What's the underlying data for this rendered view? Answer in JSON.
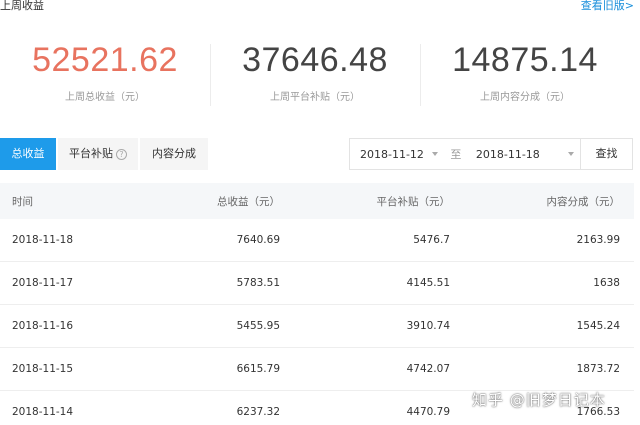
{
  "header": {
    "title": "上周收益",
    "old_version_link": "查看旧版>"
  },
  "summary": [
    {
      "value": "52521.62",
      "label": "上周总收益（元）"
    },
    {
      "value": "37646.48",
      "label": "上周平台补贴（元）"
    },
    {
      "value": "14875.14",
      "label": "上周内容分成（元）"
    }
  ],
  "colors": {
    "accent": "#e8735f",
    "tab_active": "#1e9bea",
    "link": "#1a8fdb"
  },
  "tabs": [
    {
      "label": "总收益",
      "active": true
    },
    {
      "label": "平台补贴",
      "has_help_icon": true,
      "help_icon": "?"
    },
    {
      "label": "内容分成"
    }
  ],
  "filter": {
    "start_date": "2018-11-12",
    "separator": "至",
    "end_date": "2018-11-18",
    "search_label": "查找"
  },
  "table": {
    "columns": [
      "时间",
      "总收益（元）",
      "平台补贴（元）",
      "内容分成（元）"
    ],
    "rows": [
      [
        "2018-11-18",
        "7640.69",
        "5476.7",
        "2163.99"
      ],
      [
        "2018-11-17",
        "5783.51",
        "4145.51",
        "1638"
      ],
      [
        "2018-11-16",
        "5455.95",
        "3910.74",
        "1545.24"
      ],
      [
        "2018-11-15",
        "6615.79",
        "4742.07",
        "1873.72"
      ],
      [
        "2018-11-14",
        "6237.32",
        "4470.79",
        "1766.53"
      ]
    ]
  },
  "watermark": "知乎 @旧梦日记本"
}
